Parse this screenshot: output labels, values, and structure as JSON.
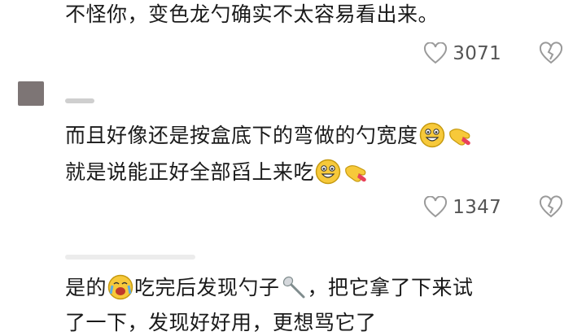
{
  "comments": [
    {
      "lines": [
        "不怪你，变色龙勺确实不太容易看出来。"
      ],
      "likes": "3071"
    },
    {
      "lines": [
        "而且好像还是按盒底下的弯做的勺宽度",
        "就是说能正好全部舀上来吃"
      ],
      "line_emojis": [
        [
          "grinning-face-icon",
          "pointing-hand-icon"
        ],
        [
          "grinning-face-icon",
          "pointing-hand-icon"
        ]
      ],
      "likes": "1347"
    },
    {
      "lines": [
        "是的",
        "吃完后发现勺子",
        "，把它拿了下来试",
        "了一下，发现好好用，更想骂它了"
      ]
    }
  ],
  "colors": {
    "text": "#1a1a1a",
    "count": "#555555",
    "icon": "#9a9a9a",
    "avatar": "#7d7575"
  }
}
